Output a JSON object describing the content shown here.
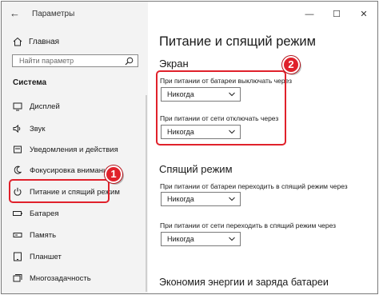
{
  "window": {
    "app_title": "Параметры",
    "controls": {
      "minimize": "—",
      "maximize": "☐",
      "close": "✕"
    },
    "back_glyph": "←"
  },
  "sidebar": {
    "home_label": "Главная",
    "search_placeholder": "Найти параметр",
    "section_label": "Система",
    "items": [
      {
        "label": "Дисплей",
        "icon": "display-icon"
      },
      {
        "label": "Звук",
        "icon": "sound-icon"
      },
      {
        "label": "Уведомления и действия",
        "icon": "notifications-icon"
      },
      {
        "label": "Фокусировка внимания",
        "icon": "focus-assist-icon"
      },
      {
        "label": "Питание и спящий режим",
        "icon": "power-icon"
      },
      {
        "label": "Батарея",
        "icon": "battery-icon"
      },
      {
        "label": "Память",
        "icon": "storage-icon"
      },
      {
        "label": "Планшет",
        "icon": "tablet-icon"
      },
      {
        "label": "Многозадачность",
        "icon": "multitasking-icon"
      }
    ],
    "selected_index": 4
  },
  "main": {
    "page_title": "Питание и спящий режим",
    "screen": {
      "heading": "Экран",
      "battery_label": "При питании от батареи выключать через",
      "battery_value": "Никогда",
      "plugged_label": "При питании от сети отключать через",
      "plugged_value": "Никогда"
    },
    "sleep": {
      "heading": "Спящий режим",
      "battery_label": "При питании от батареи переходить в спящий режим через",
      "battery_value": "Никогда",
      "plugged_label": "При питании от сети переходить в спящий режим через",
      "plugged_value": "Никогда"
    },
    "eco_heading": "Экономия энергии и заряда батареи"
  },
  "annotations": {
    "badge_1": "1",
    "badge_2": "2",
    "color": "#e0212b"
  }
}
